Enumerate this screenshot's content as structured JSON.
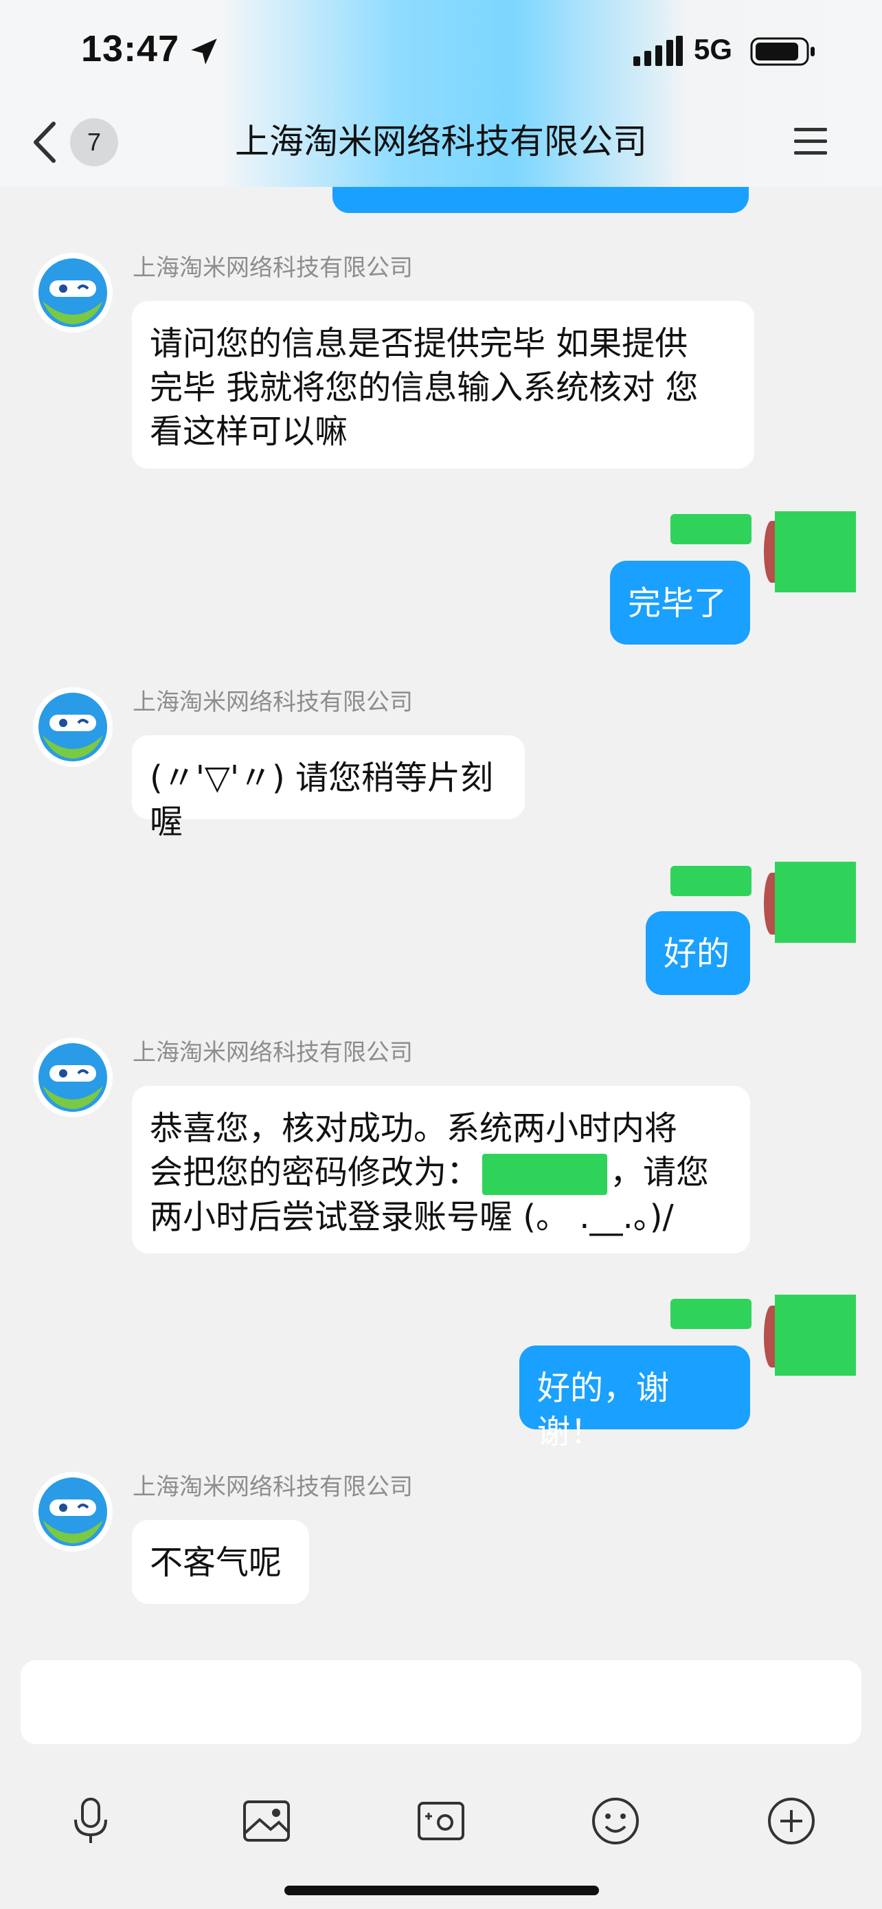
{
  "status_bar": {
    "time": "13:47",
    "network": "5G"
  },
  "nav": {
    "back_count": "7",
    "title": "上海淘米网络科技有限公司"
  },
  "messages": [
    {
      "sender": "上海淘米网络科技有限公司",
      "lines": [
        "请问您的信息是否提供完毕 如果提供",
        "完毕 我就将您的信息输入系统核对 您",
        "看这样可以嘛"
      ]
    },
    {
      "text": "完毕了"
    },
    {
      "sender": "上海淘米网络科技有限公司",
      "text": "(〃'▽'〃) 请您稍等片刻喔"
    },
    {
      "text": "好的"
    },
    {
      "sender": "上海淘米网络科技有限公司",
      "line1": "恭喜您，核对成功。系统两小时内将",
      "line2_a": "会把您的密码修改为：",
      "line2_b": "，请您",
      "line3": "两小时后尝试登录账号喔 (。 .__.。)/"
    },
    {
      "text": "好的，谢谢！"
    },
    {
      "sender": "上海淘米网络科技有限公司",
      "text": "不客气呢"
    }
  ],
  "colors": {
    "outgoing_bubble": "#1aa0ff",
    "incoming_bubble": "#ffffff",
    "redaction": "#2fd35a",
    "background": "#f1f1f1"
  },
  "input": {
    "value": ""
  },
  "toolbar_icons": [
    "microphone-icon",
    "image-icon",
    "camera-icon",
    "emoji-icon",
    "plus-icon"
  ]
}
